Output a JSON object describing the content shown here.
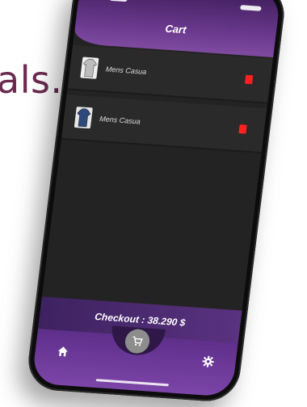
{
  "background": {
    "text": "als."
  },
  "header": {
    "title": "Cart"
  },
  "cart": {
    "items": [
      {
        "name": "Mens Casua",
        "icon": "shirt-light-icon"
      },
      {
        "name": "Mens Casua",
        "icon": "shirt-dark-icon"
      }
    ],
    "checkout_label": "Checkout : 38.290 $"
  },
  "nav": {
    "home_icon": "home-icon",
    "cart_icon": "cart-icon",
    "settings_icon": "gear-icon"
  },
  "colors": {
    "accent": "#6b3a8f",
    "delete": "#ff2020",
    "screen_bg": "#232323"
  }
}
